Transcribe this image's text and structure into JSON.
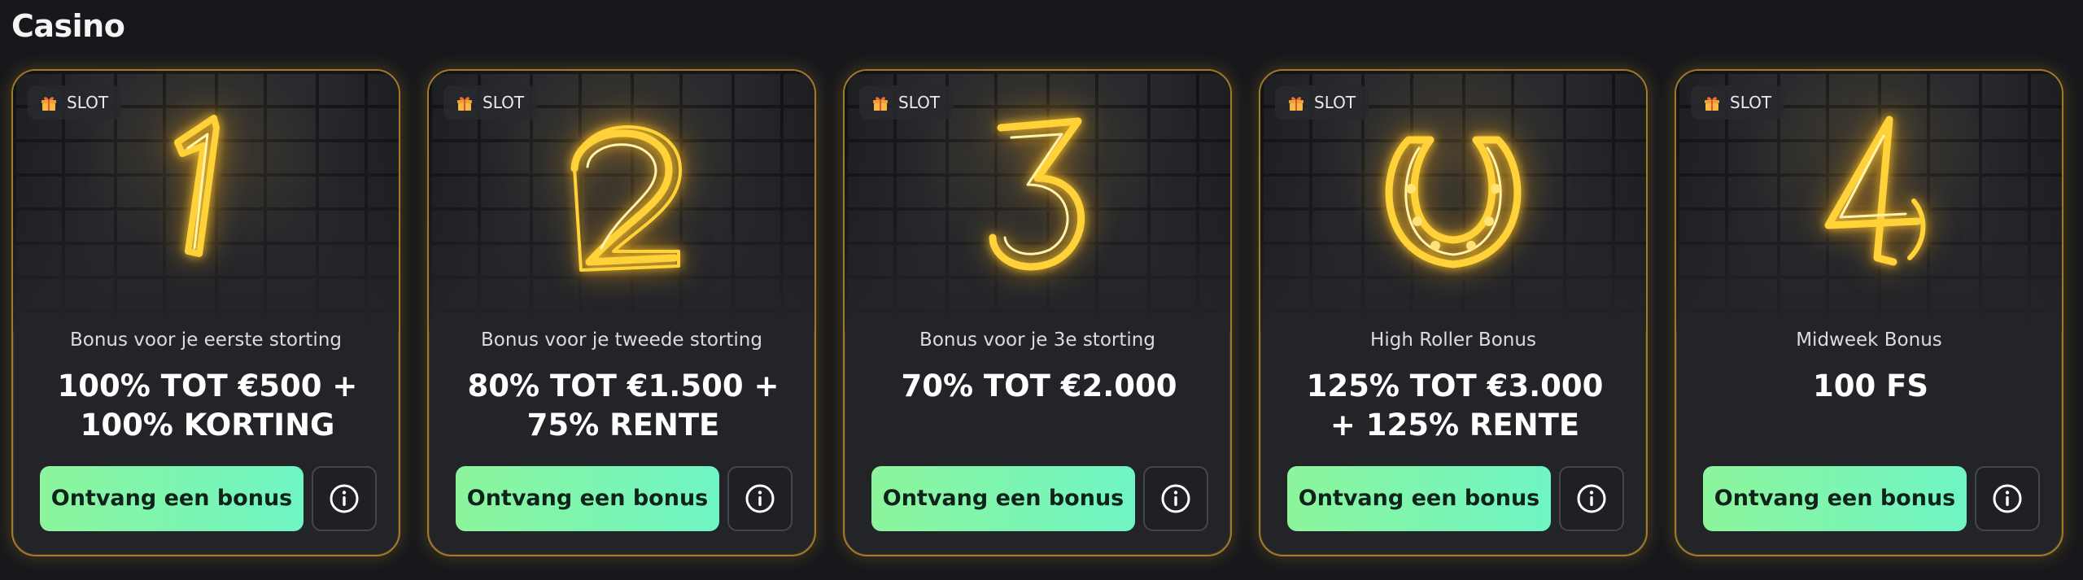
{
  "section": {
    "title": "Casino"
  },
  "colors": {
    "neon": "#ffd23a",
    "cta_start": "#8cf59c",
    "cta_end": "#6ff5c4",
    "card_border": "#a07b2a"
  },
  "cards": [
    {
      "tag": "SLOT",
      "tag_icon": "gift-icon",
      "neon_icon": "neon-number-1",
      "subtitle": "Bonus voor je eerste storting",
      "offer": "100% TOT €500 + 100% KORTING",
      "cta": "Ontvang een bonus",
      "info_icon": "info-icon"
    },
    {
      "tag": "SLOT",
      "tag_icon": "gift-icon",
      "neon_icon": "neon-number-2",
      "subtitle": "Bonus voor je tweede storting",
      "offer": "80% TOT €1.500 + 75% RENTE",
      "cta": "Ontvang een bonus",
      "info_icon": "info-icon"
    },
    {
      "tag": "SLOT",
      "tag_icon": "gift-icon",
      "neon_icon": "neon-number-3",
      "subtitle": "Bonus voor je 3e storting",
      "offer": "70% TOT €2.000",
      "cta": "Ontvang een bonus",
      "info_icon": "info-icon"
    },
    {
      "tag": "SLOT",
      "tag_icon": "gift-icon",
      "neon_icon": "neon-horseshoe",
      "subtitle": "High Roller Bonus",
      "offer": "125% TOT €3.000 + 125% RENTE",
      "cta": "Ontvang een bonus",
      "info_icon": "info-icon"
    },
    {
      "tag": "SLOT",
      "tag_icon": "gift-icon",
      "neon_icon": "neon-number-4",
      "subtitle": "Midweek Bonus",
      "offer": "100 FS",
      "cta": "Ontvang een bonus",
      "info_icon": "info-icon"
    }
  ]
}
